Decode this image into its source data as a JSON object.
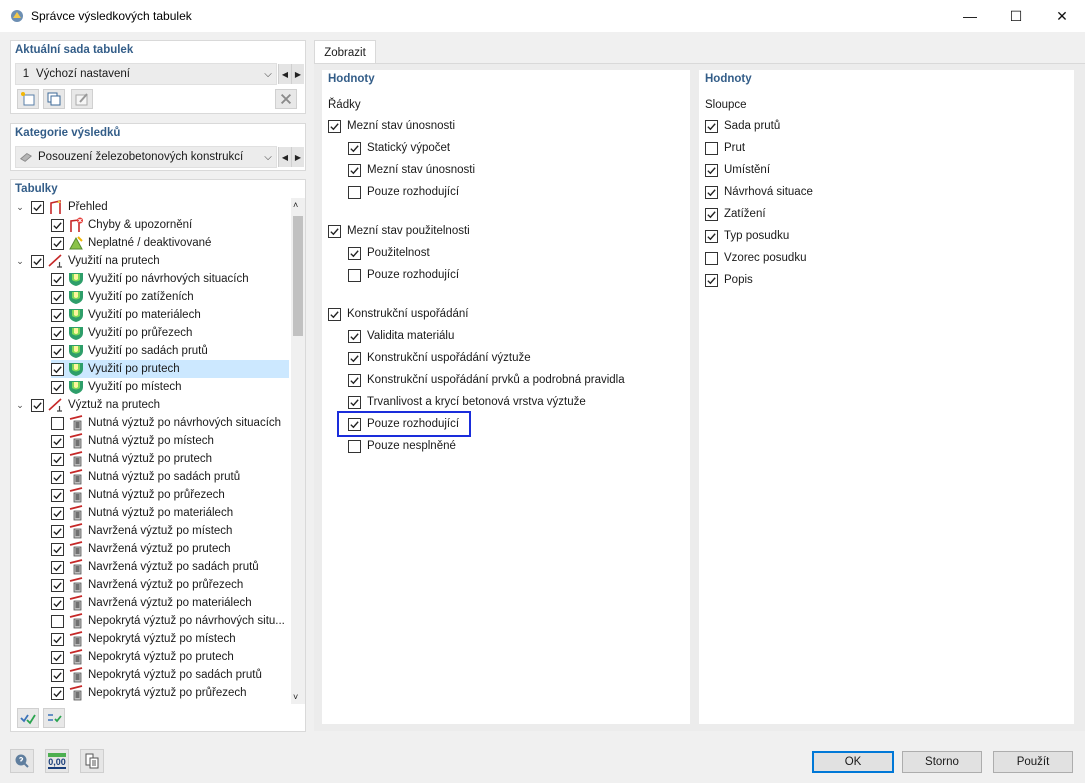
{
  "window": {
    "title": "Správce výsledkových tabulek",
    "minimize": "—",
    "maximize": "☐",
    "close": "✕"
  },
  "table_set": {
    "heading": "Aktuální sada tabulek",
    "number": "1",
    "value": "Výchozí nastavení"
  },
  "category": {
    "heading": "Kategorie výsledků",
    "value": "Posouzení železobetonových konstrukcí"
  },
  "tables": {
    "heading": "Tabulky",
    "items": [
      {
        "label": "Přehled",
        "level": 0,
        "checked": true,
        "icon": "overview-icon",
        "expander": "⌄"
      },
      {
        "label": "Chyby & upozornění",
        "level": 1,
        "checked": true,
        "icon": "errors-warnings-icon"
      },
      {
        "label": "Neplatné / deaktivované",
        "level": 1,
        "checked": true,
        "icon": "invalid-deactivated-icon"
      },
      {
        "label": "Využití na prutech",
        "level": 0,
        "checked": true,
        "icon": "member-utilization-icon",
        "expander": "⌄"
      },
      {
        "label": "Využití po návrhových situacích",
        "level": 1,
        "checked": true,
        "icon": "utilization-shield-icon"
      },
      {
        "label": "Využití po zatíženích",
        "level": 1,
        "checked": true,
        "icon": "utilization-shield-icon"
      },
      {
        "label": "Využití po materiálech",
        "level": 1,
        "checked": true,
        "icon": "utilization-shield-icon"
      },
      {
        "label": "Využití po průřezech",
        "level": 1,
        "checked": true,
        "icon": "utilization-shield-icon"
      },
      {
        "label": "Využití po sadách prutů",
        "level": 1,
        "checked": true,
        "icon": "utilization-shield-icon"
      },
      {
        "label": "Využití po prutech",
        "level": 1,
        "checked": true,
        "icon": "utilization-shield-icon",
        "selected": true
      },
      {
        "label": "Využití po místech",
        "level": 1,
        "checked": true,
        "icon": "utilization-shield-icon"
      },
      {
        "label": "Výztuž na prutech",
        "level": 0,
        "checked": true,
        "icon": "member-reinforcement-icon",
        "expander": "⌄"
      },
      {
        "label": "Nutná výztuž po návrhových situacích",
        "level": 1,
        "checked": false,
        "icon": "reinforcement-icon"
      },
      {
        "label": "Nutná výztuž po místech",
        "level": 1,
        "checked": true,
        "icon": "reinforcement-icon"
      },
      {
        "label": "Nutná výztuž po prutech",
        "level": 1,
        "checked": true,
        "icon": "reinforcement-icon"
      },
      {
        "label": "Nutná výztuž po sadách prutů",
        "level": 1,
        "checked": true,
        "icon": "reinforcement-icon"
      },
      {
        "label": "Nutná výztuž po průřezech",
        "level": 1,
        "checked": true,
        "icon": "reinforcement-icon"
      },
      {
        "label": "Nutná výztuž po materiálech",
        "level": 1,
        "checked": true,
        "icon": "reinforcement-icon"
      },
      {
        "label": "Navržená výztuž po místech",
        "level": 1,
        "checked": true,
        "icon": "reinforcement-icon"
      },
      {
        "label": "Navržená výztuž po prutech",
        "level": 1,
        "checked": true,
        "icon": "reinforcement-icon"
      },
      {
        "label": "Navržená výztuž po sadách prutů",
        "level": 1,
        "checked": true,
        "icon": "reinforcement-icon"
      },
      {
        "label": "Navržená výztuž po průřezech",
        "level": 1,
        "checked": true,
        "icon": "reinforcement-icon"
      },
      {
        "label": "Navržená výztuž po materiálech",
        "level": 1,
        "checked": true,
        "icon": "reinforcement-icon"
      },
      {
        "label": "Nepokrytá výztuž po návrhových situ...",
        "level": 1,
        "checked": false,
        "icon": "reinforcement-icon"
      },
      {
        "label": "Nepokrytá výztuž po místech",
        "level": 1,
        "checked": true,
        "icon": "reinforcement-icon"
      },
      {
        "label": "Nepokrytá výztuž po prutech",
        "level": 1,
        "checked": true,
        "icon": "reinforcement-icon"
      },
      {
        "label": "Nepokrytá výztuž po sadách prutů",
        "level": 1,
        "checked": true,
        "icon": "reinforcement-icon"
      },
      {
        "label": "Nepokrytá výztuž po průřezech",
        "level": 1,
        "checked": true,
        "icon": "reinforcement-icon"
      }
    ]
  },
  "tab": {
    "label": "Zobrazit"
  },
  "rows_panel": {
    "heading": "Hodnoty",
    "sublabel": "Řádky",
    "items": [
      {
        "label": "Mezní stav únosnosti",
        "checked": true,
        "level": 0
      },
      {
        "label": "Statický výpočet",
        "checked": true,
        "level": 1
      },
      {
        "label": "Mezní stav únosnosti",
        "checked": true,
        "level": 1
      },
      {
        "label": "Pouze rozhodující",
        "checked": false,
        "level": 1
      },
      {
        "label": "Mezní stav použitelnosti",
        "checked": true,
        "level": 0
      },
      {
        "label": "Použitelnost",
        "checked": true,
        "level": 1
      },
      {
        "label": "Pouze rozhodující",
        "checked": false,
        "level": 1
      },
      {
        "label": "Konstrukční uspořádání",
        "checked": true,
        "level": 0
      },
      {
        "label": "Validita materiálu",
        "checked": true,
        "level": 1
      },
      {
        "label": "Konstrukční uspořádání výztuže",
        "checked": true,
        "level": 1
      },
      {
        "label": "Konstrukční uspořádání prvků a podrobná pravidla",
        "checked": true,
        "level": 1
      },
      {
        "label": "Trvanlivost a krycí betonová vrstva výztuže",
        "checked": true,
        "level": 1
      },
      {
        "label": "Pouze rozhodující",
        "checked": true,
        "level": 1,
        "highlighted": true
      },
      {
        "label": "Pouze nesplněné",
        "checked": false,
        "level": 1
      }
    ]
  },
  "columns_panel": {
    "heading": "Hodnoty",
    "sublabel": "Sloupce",
    "items": [
      {
        "label": "Sada prutů",
        "checked": true
      },
      {
        "label": "Prut",
        "checked": false
      },
      {
        "label": "Umístění",
        "checked": true
      },
      {
        "label": "Návrhová situace",
        "checked": true
      },
      {
        "label": "Zatížení",
        "checked": true
      },
      {
        "label": "Typ posudku",
        "checked": true
      },
      {
        "label": "Vzorec posudku",
        "checked": false
      },
      {
        "label": "Popis",
        "checked": true
      }
    ]
  },
  "footer": {
    "ok": "OK",
    "cancel": "Storno",
    "apply": "Použít",
    "units_icon_text": "0,00"
  }
}
